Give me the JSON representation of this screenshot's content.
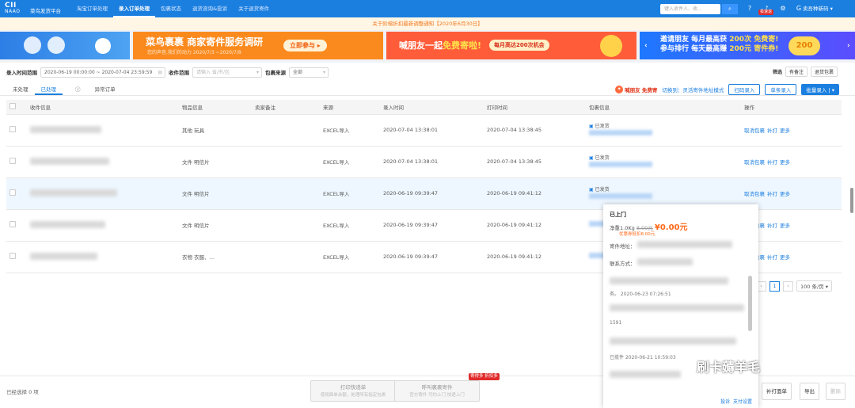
{
  "topbar": {
    "logo_top": "CII",
    "logo_bottom": "NAAO",
    "platform": "菜鸟发货平台",
    "nav": [
      "淘宝订单处理",
      "录入订单处理",
      "包裹状态",
      "退货咨询&投诉",
      "关于退货寄件"
    ],
    "active_nav_index": 1,
    "search_placeholder": "键入收件人、收…",
    "badge": "极速退",
    "user": "卖吾种新码"
  },
  "notice": "关于阶梯折扣最新调整通知【2020年6月30日】",
  "banners": {
    "b2_title": "菜鸟裹裹 商家寄件服务调研",
    "b2_sub": "您的声音,我们的动力 2020/7/3 ~2020/7/8",
    "b2_btn": "立即参与 ▸",
    "b3_title_a": "喊朋友一起",
    "b3_title_b": "免费寄啦!",
    "b3_pill": "每月高达200次机会",
    "b4_line1_a": "邀请朋友 每月最高获 ",
    "b4_line1_b": "200次 免费寄!",
    "b4_line2_a": "参与排行 每天最高赚 ",
    "b4_line2_b": "200元 寄件券!",
    "b4_coin": "200"
  },
  "filters": {
    "time_label": "录入时间范围",
    "time_value": "2020-06-19 00:00:00 ~ 2020-07-04 23:59:59",
    "recv_label": "收件范围",
    "recv_placeholder": "请输入 省/市/区",
    "source_label": "包裹来源",
    "source_value": "全部",
    "filter_label": "筛选",
    "has_note": "有备注",
    "return_pkg": "退货包裹"
  },
  "tabs": [
    "未处理",
    "已处理",
    "异常订单"
  ],
  "active_tab_index": 1,
  "actions": {
    "promo": "喊朋友 免费寄",
    "switch_link": "切换到：灵活寄件地址模式",
    "scan": "扫码录入",
    "single": "单条录入",
    "batch": "批量录入"
  },
  "table": {
    "headers": [
      "收件信息",
      "物品信息",
      "卖家备注",
      "来源",
      "录入时间",
      "打印时间",
      "包裹信息",
      "操作"
    ],
    "rows": [
      {
        "item": "其他 玩具",
        "source": "EXCEL导入",
        "entered": "2020-07-04 13:38:01",
        "printed": "2020-07-04 13:38:45",
        "status": "已发货",
        "ops": [
          "取消包裹",
          "补打",
          "更多"
        ]
      },
      {
        "item": "文件 明信片",
        "source": "EXCEL导入",
        "entered": "2020-07-04 13:38:01",
        "printed": "2020-07-04 13:38:45",
        "status": "已发货",
        "ops": [
          "取消包裹",
          "补打",
          "更多"
        ]
      },
      {
        "item": "文件 明信片",
        "source": "EXCEL导入",
        "entered": "2020-06-19 09:39:47",
        "printed": "2020-06-19 09:41:12",
        "status": "已发货",
        "ops": [
          "取消包裹",
          "补打",
          "更多"
        ]
      },
      {
        "item": "文件 明信片",
        "source": "EXCEL导入",
        "entered": "2020-06-19 09:39:47",
        "printed": "2020-06-19 09:41:12",
        "status": "",
        "ops": [
          "取消包裹",
          "补打",
          "更多"
        ]
      },
      {
        "item": "衣物 衣服、…",
        "source": "EXCEL导入",
        "entered": "2020-06-19 09:39:47",
        "printed": "2020-06-19 09:41:12",
        "status": "",
        "ops": [
          "取消包裹",
          "补打",
          "更多"
        ]
      }
    ]
  },
  "pager": {
    "current": "1",
    "size": "100 条/页"
  },
  "popup": {
    "title": "已上门",
    "weight": "净重1.0Kg",
    "old_price": "8.00元",
    "price": "¥0.00元",
    "discount": "优惠券抵扣8.00元",
    "addr_label": "寄件地址：",
    "contact_label": "联系方式：",
    "t1": "务。 2020-06-23 07:26:51",
    "t2": "1591",
    "t3": "2020-06-21 10:59:03",
    "t3_prefix": "已揽件",
    "foot_a": "投诉",
    "foot_b": "支付设置"
  },
  "bottom": {
    "selected": "已经选择 0 项",
    "print_title": "打印快递单",
    "print_sub": "使用面单余额，处理所有指定包裹",
    "call_title": "呼叫裹裹寄件",
    "call_sub": "官方寄件 可约上门 快递上门",
    "red_tag": "寄得多 折扣多",
    "reprint": "补打面单",
    "export": "导出",
    "delete": "删除"
  },
  "watermark": "刷卡薅羊毛"
}
